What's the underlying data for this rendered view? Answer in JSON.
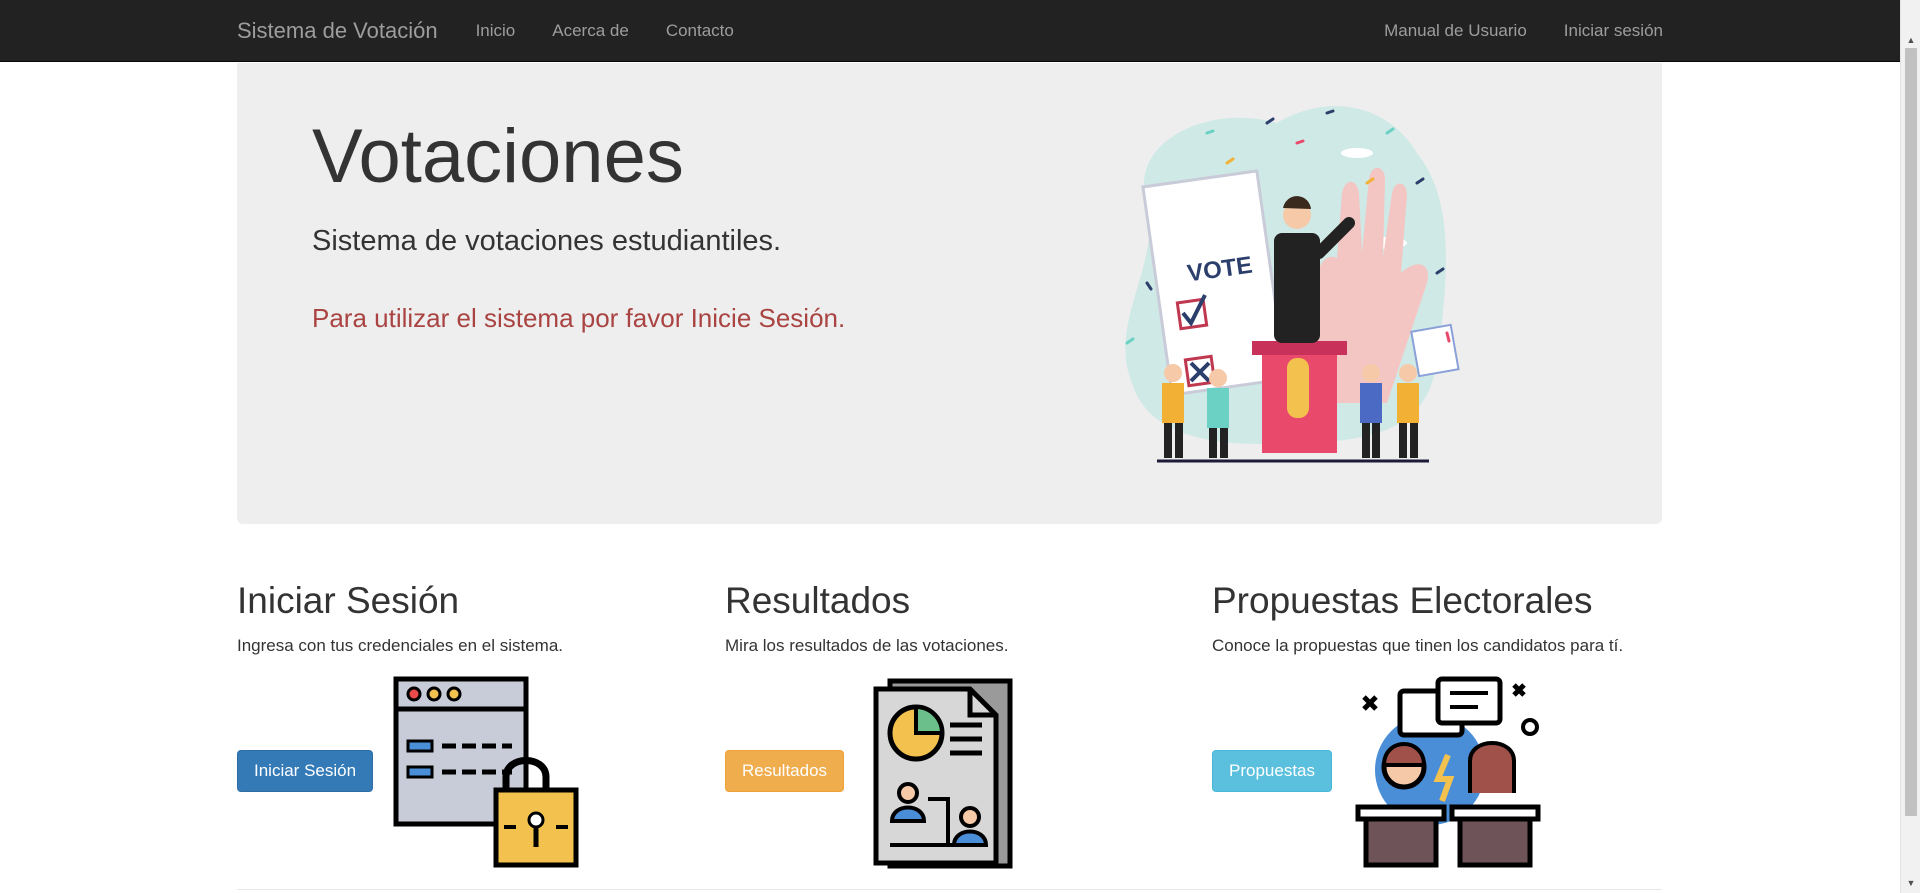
{
  "navbar": {
    "brand": "Sistema de Votación",
    "links_left": [
      "Inicio",
      "Acerca de",
      "Contacto"
    ],
    "links_right": [
      "Manual de Usuario",
      "Iniciar sesión"
    ]
  },
  "hero": {
    "title": "Votaciones",
    "subtitle": "Sistema de votaciones estudiantiles.",
    "notice": "Para utilizar el sistema por favor Inicie Sesión.",
    "illustration_sign": "VOTE"
  },
  "features": [
    {
      "heading": "Iniciar Sesión",
      "description": "Ingresa con tus credenciales en el sistema.",
      "button": "Iniciar Sesión",
      "icon": "login-lock-icon",
      "button_color": "#337ab7"
    },
    {
      "heading": "Resultados",
      "description": "Mira los resultados de las votaciones.",
      "button": "Resultados",
      "icon": "results-report-icon",
      "button_color": "#f0ad4e"
    },
    {
      "heading": "Propuestas Electorales",
      "description": "Conoce la propuestas que tinen los candidatos para tí.",
      "button": "Propuestas",
      "icon": "debate-icon",
      "button_color": "#5bc0de"
    }
  ],
  "colors": {
    "navbar_bg": "#222222",
    "navbar_text": "#9d9d9d",
    "jumbotron_bg": "#eeeeee",
    "notice": "#a94442"
  }
}
